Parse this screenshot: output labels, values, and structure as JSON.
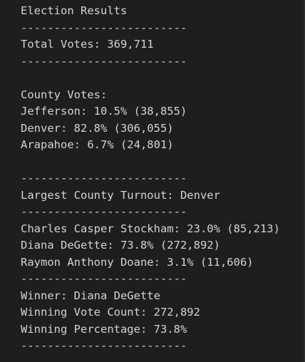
{
  "output": {
    "title": "Election Results",
    "separator": "-------------------------",
    "total_votes": "Total Votes: 369,711",
    "county_header": "County Votes:",
    "counties": [
      "Jefferson: 10.5% (38,855)",
      "Denver: 82.8% (306,055)",
      "Arapahoe: 6.7% (24,801)"
    ],
    "largest_county": "Largest County Turnout: Denver",
    "candidates": [
      "Charles Casper Stockham: 23.0% (85,213)",
      "Diana DeGette: 73.8% (272,892)",
      "Raymon Anthony Doane: 3.1% (11,606)"
    ],
    "winner": "Winner: Diana DeGette",
    "winning_vote_count": "Winning Vote Count: 272,892",
    "winning_percentage": "Winning Percentage: 73.8%"
  },
  "colors": {
    "background": "#1e1e1e",
    "text": "#d4d4d4"
  }
}
